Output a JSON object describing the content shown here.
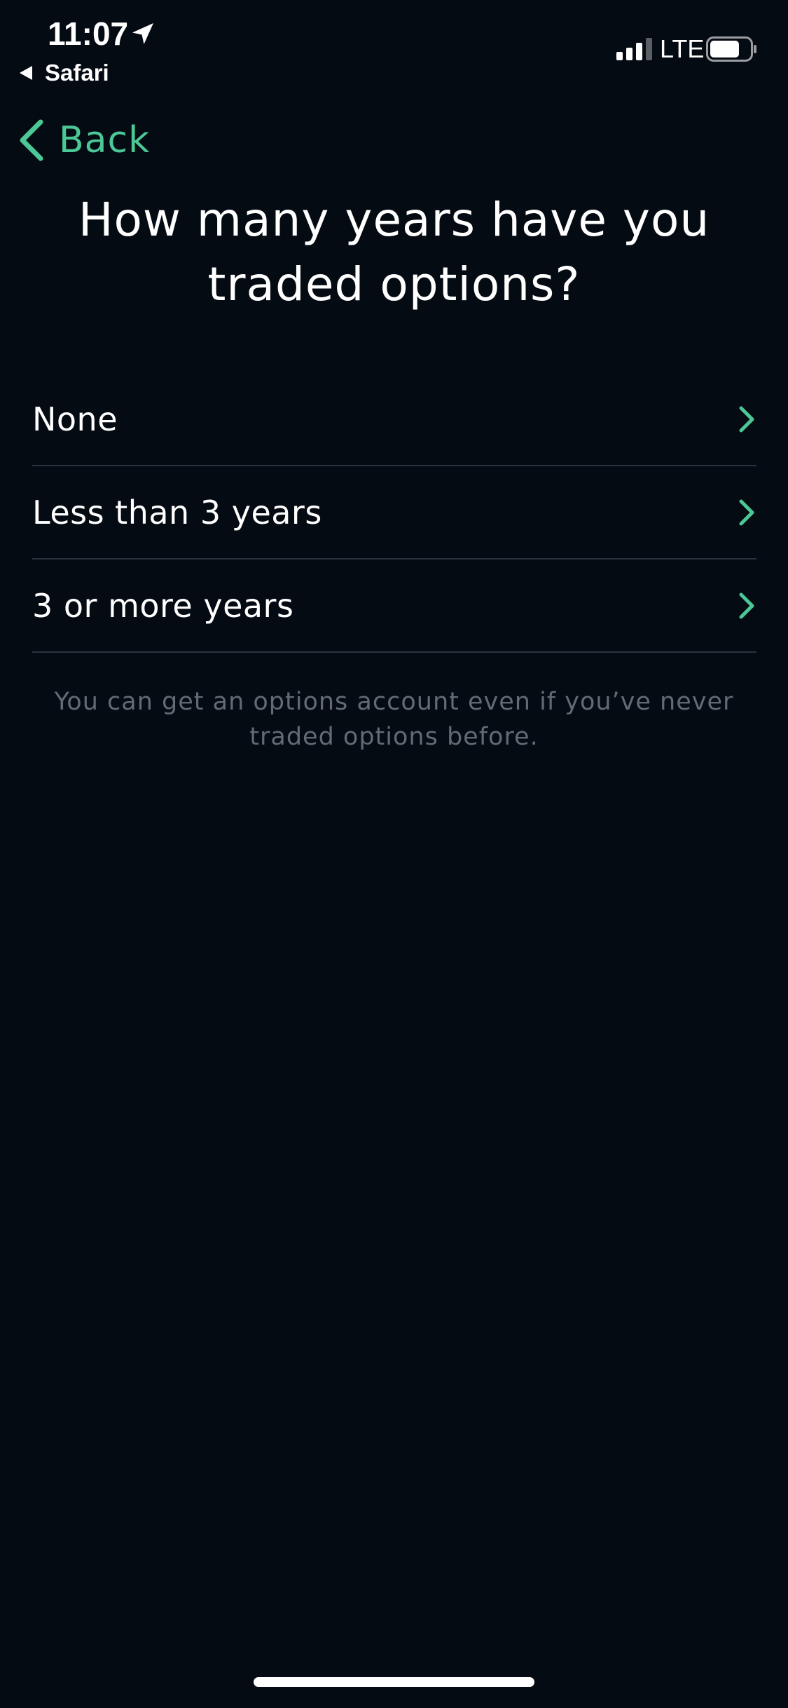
{
  "status_bar": {
    "time": "11:07",
    "back_app_label": "Safari",
    "network": "LTE",
    "signal_bars_active": 3,
    "signal_bars_total": 4,
    "battery_level": 0.75
  },
  "nav": {
    "back_label": "Back"
  },
  "title": "How many years have you traded options?",
  "options": [
    {
      "label": "None"
    },
    {
      "label": "Less than 3 years"
    },
    {
      "label": "3 or more years"
    }
  ],
  "footnote": "You can get an options account even if you’ve never traded options before.",
  "colors": {
    "background": "#050b13",
    "accent": "#4cc897",
    "text": "#ffffff",
    "muted": "#636a73",
    "divider": "#2b323b"
  },
  "icons": {
    "location": "location-arrow-icon",
    "signal": "cellular-signal-icon",
    "battery": "battery-icon",
    "back": "chevron-left-icon",
    "row": "chevron-right-icon"
  }
}
